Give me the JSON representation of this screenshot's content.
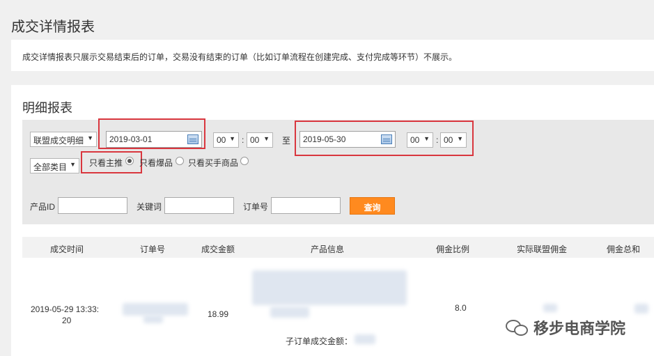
{
  "page": {
    "title": "成交详情报表"
  },
  "notice": {
    "text": "成交详情报表只展示交易结束后的订单，交易没有结束的订单（比如订单流程在创建完成、支付完成等环节）不展示。"
  },
  "section": {
    "title": "明细报表"
  },
  "filters": {
    "report_type": "联盟成交明细",
    "start_date": "2019-03-01",
    "start_hour": "00",
    "start_minute": "00",
    "to_label": "至",
    "end_date": "2019-05-30",
    "end_hour": "00",
    "end_minute": "00",
    "category": "全部类目",
    "radios": [
      {
        "label": "只看主推",
        "checked": true
      },
      {
        "label": "只看爆品",
        "checked": false
      },
      {
        "label": "只看买手商品",
        "checked": false
      }
    ],
    "product_id_label": "产品ID",
    "keyword_label": "关键词",
    "order_no_label": "订单号",
    "query_button": "查询"
  },
  "table": {
    "headers": [
      "成交时间",
      "订单号",
      "成交金额",
      "产品信息",
      "佣金比例",
      "实际联盟佣金",
      "佣金总和"
    ],
    "row": {
      "time_line1": "2019-05-29 13:33:",
      "time_line2": "20",
      "amount": "18.99",
      "commission_rate": "8.0",
      "sub_order_label": "子订单成交金额："
    }
  },
  "watermark": {
    "text": "移步电商学院"
  },
  "colors": {
    "highlight": "#d9363e",
    "query_button": "#ff8a1f"
  }
}
